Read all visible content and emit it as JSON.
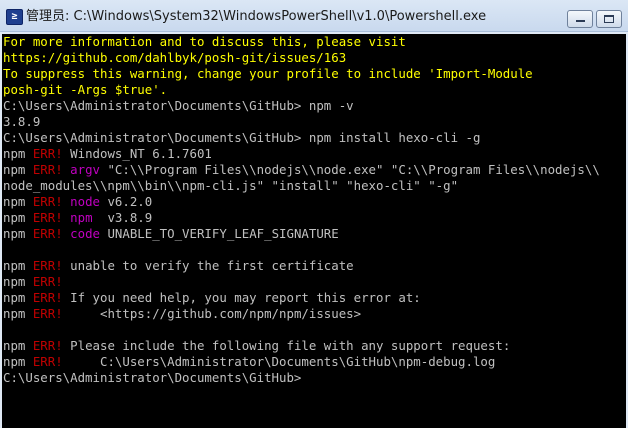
{
  "window": {
    "icon_char": "≥",
    "title": "管理员: C:\\Windows\\System32\\WindowsPowerShell\\v1.0\\Powershell.exe",
    "icon_name": "powershell-icon"
  },
  "colors": {
    "background": "#000000",
    "text": "#c0c0c0",
    "warning": "#ffff00",
    "err": "#c00000",
    "keyword": "#c000c0"
  },
  "console": {
    "warning": [
      "For more information and to discuss this, please visit",
      "https://github.com/dahlbyk/posh-git/issues/163",
      "To suppress this warning, change your profile to include 'Import-Module",
      "posh-git -Args $true'."
    ],
    "prompt": "C:\\Users\\Administrator\\Documents\\GitHub>",
    "cmd1": " npm -v",
    "version_output": "3.8.9",
    "cmd2": " npm install hexo-cli -g",
    "npm": "npm ",
    "err": "ERR!",
    "os_line": " Windows_NT 6.1.7601",
    "argv_key": "argv",
    "argv_part1": " \"C:\\\\Program Files\\\\nodejs\\\\node.exe\" \"C:\\\\Program Files\\\\nodejs\\\\",
    "argv_part2": "node_modules\\\\npm\\\\bin\\\\npm-cli.js\" \"install\" \"hexo-cli\" \"-g\"",
    "node_key": "node",
    "node_val": " v6.2.0",
    "npm_key": "npm ",
    "npm_val": " v3.8.9",
    "code_key": "code",
    "code_val": " UNABLE_TO_VERIFY_LEAF_SIGNATURE",
    "unable_msg": " unable to verify the first certificate",
    "help_msg": " If you need help, you may report this error at:",
    "help_url": "     <https://github.com/npm/npm/issues>",
    "include_msg": " Please include the following file with any support request:",
    "log_path": "     C:\\Users\\Administrator\\Documents\\GitHub\\npm-debug.log"
  }
}
